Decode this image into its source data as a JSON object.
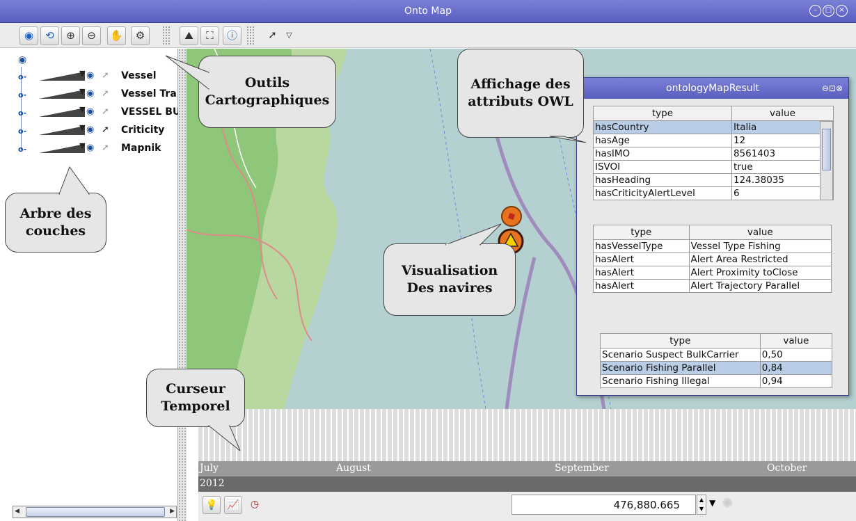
{
  "window": {
    "title": "Onto Map"
  },
  "layers": [
    {
      "name": "Vessel",
      "pointer_active": false
    },
    {
      "name": "Vessel Tra",
      "pointer_active": false
    },
    {
      "name": "VESSEL BU",
      "pointer_active": false
    },
    {
      "name": "Criticity",
      "pointer_active": true
    },
    {
      "name": "Mapnik",
      "pointer_active": false
    }
  ],
  "result_window": {
    "title": "ontologyMapResult",
    "table1": {
      "headers": [
        "type",
        "value"
      ],
      "rows": [
        [
          "hasCountry",
          "Italia"
        ],
        [
          "hasAge",
          "12"
        ],
        [
          "hasIMO",
          "8561403"
        ],
        [
          "ISVOI",
          "true"
        ],
        [
          "hasHeading",
          "124.38035"
        ],
        [
          "hasCriticityAlertLevel",
          "6"
        ]
      ],
      "selected_row": 0
    },
    "table2": {
      "headers": [
        "type",
        "value"
      ],
      "rows": [
        [
          "hasVesselType",
          "Vessel Type Fishing"
        ],
        [
          "hasAlert",
          "Alert Area Restricted"
        ],
        [
          "hasAlert",
          "Alert Proximity toClose"
        ],
        [
          "hasAlert",
          "Alert Trajectory Parallel"
        ]
      ]
    },
    "table3": {
      "headers": [
        "type",
        "value"
      ],
      "rows": [
        [
          "Scenario Suspect BulkCarrier",
          "0,50"
        ],
        [
          "Scenario Fishing Parallel",
          "0,84"
        ],
        [
          "Scenario Fishing Illegal",
          "0,94"
        ]
      ],
      "selected_row": 1
    }
  },
  "timeline": {
    "months": [
      "July",
      "August",
      "September",
      "October"
    ],
    "year": "2012",
    "spinner_value": "476,880.665"
  },
  "callouts": {
    "outils": [
      "Outils",
      "Cartographiques"
    ],
    "affichage": [
      "Affichage des",
      "attributs OWL"
    ],
    "arbre": [
      "Arbre des",
      "couches"
    ],
    "visualisation": [
      "Visualisation",
      "Des navires"
    ],
    "curseur": [
      "Curseur",
      "Temporel"
    ]
  },
  "colors": {
    "titlebar": "#5a5fc0",
    "selection": "#b9cde6",
    "vessel_marker": "#e8731e"
  }
}
